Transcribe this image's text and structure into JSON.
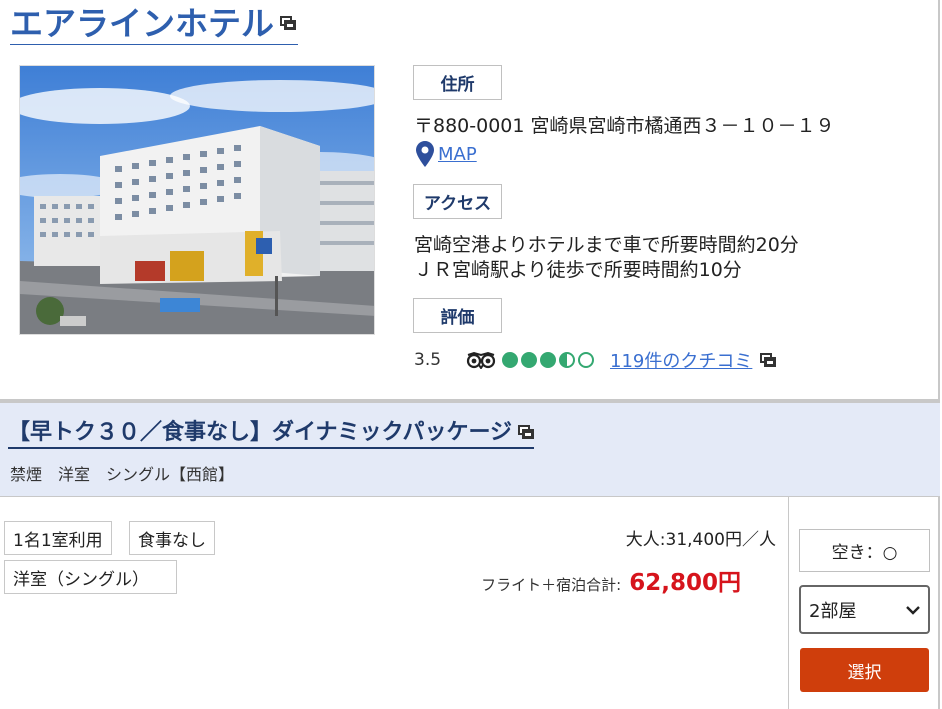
{
  "hotel": {
    "name": "エアラインホテル",
    "labels": {
      "address": "住所",
      "access": "アクセス",
      "rating": "評価"
    },
    "address": "〒880-0001 宮崎県宮崎市橘通西３－１０－１９",
    "map_label": "MAP",
    "access_lines": [
      "宮崎空港よりホテルまで車で所要時間約20分",
      "ＪＲ宮崎駅より徒歩で所要時間約10分"
    ],
    "rating_value": "3.5",
    "rating_dots": [
      1,
      1,
      1,
      0.5,
      0
    ],
    "reviews_label": "119件のクチコミ"
  },
  "plan": {
    "title": "【早トク３０／食事なし】ダイナミックパッケージ",
    "room_desc": "禁煙　洋室　シングル【西館】",
    "tags": [
      "1名1室利用",
      "食事なし",
      "洋室（シングル）"
    ],
    "adult_price": "大人:31,400円／人",
    "total_label": "フライト＋宿泊合計:",
    "total_price": "62,800円",
    "vacancy": "空き：○",
    "rooms_selected": "2部屋",
    "select_label": "選択"
  },
  "colors": {
    "link": "#3a6fd0",
    "title": "#2e5fae",
    "plan_band": "#e4eaf7",
    "price": "#d6141c",
    "button": "#cf3e0c",
    "rating": "#34a871"
  }
}
